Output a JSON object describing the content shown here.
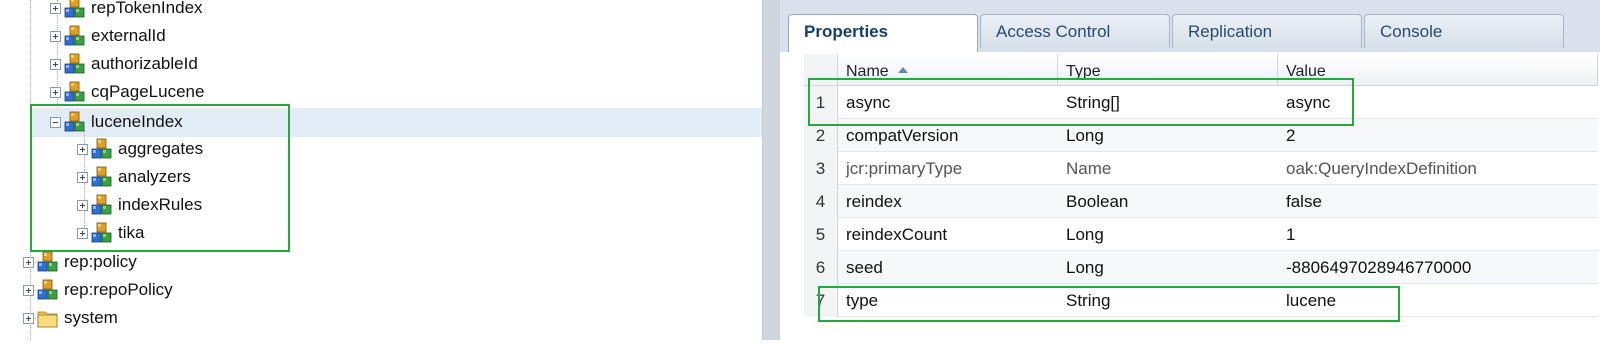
{
  "tree": {
    "items": [
      {
        "label": "repTokenIndex",
        "expander": "plus",
        "icon": "node-icon"
      },
      {
        "label": "externalId",
        "expander": "plus",
        "icon": "node-icon"
      },
      {
        "label": "authorizableId",
        "expander": "plus",
        "icon": "node-icon"
      },
      {
        "label": "cqPageLucene",
        "expander": "plus",
        "icon": "node-icon"
      },
      {
        "label": "luceneIndex",
        "expander": "minus",
        "icon": "node-icon",
        "selected": true
      },
      {
        "label": "aggregates",
        "expander": "plus",
        "icon": "node-icon"
      },
      {
        "label": "analyzers",
        "expander": "plus",
        "icon": "node-icon"
      },
      {
        "label": "indexRules",
        "expander": "plus",
        "icon": "node-icon"
      },
      {
        "label": "tika",
        "expander": "plus",
        "icon": "node-icon"
      },
      {
        "label": "rep:policy",
        "expander": "plus",
        "icon": "node-icon"
      },
      {
        "label": "rep:repoPolicy",
        "expander": "plus",
        "icon": "node-icon"
      },
      {
        "label": "system",
        "expander": "plus",
        "icon": "folder-icon"
      }
    ]
  },
  "tabs": [
    {
      "label": "Properties",
      "active": true
    },
    {
      "label": "Access Control"
    },
    {
      "label": "Replication"
    },
    {
      "label": "Console"
    }
  ],
  "grid": {
    "columns": [
      "Name",
      "Type",
      "Value"
    ],
    "sorted_column": "Name",
    "rows": [
      {
        "num": "1",
        "name": "async",
        "type": "String[]",
        "value": "async"
      },
      {
        "num": "2",
        "name": "compatVersion",
        "type": "Long",
        "value": "2"
      },
      {
        "num": "3",
        "name": "jcr:primaryType",
        "type": "Name",
        "value": "oak:QueryIndexDefinition",
        "muted": true
      },
      {
        "num": "4",
        "name": "reindex",
        "type": "Boolean",
        "value": "false"
      },
      {
        "num": "5",
        "name": "reindexCount",
        "type": "Long",
        "value": "1"
      },
      {
        "num": "6",
        "name": "seed",
        "type": "Long",
        "value": "-8806497028946770000"
      },
      {
        "num": "7",
        "name": "type",
        "type": "String",
        "value": "lucene"
      }
    ]
  },
  "colors": {
    "highlight": "#22aa3a",
    "selection": "#e1ecf7",
    "active_tab_text": "#15406e"
  }
}
